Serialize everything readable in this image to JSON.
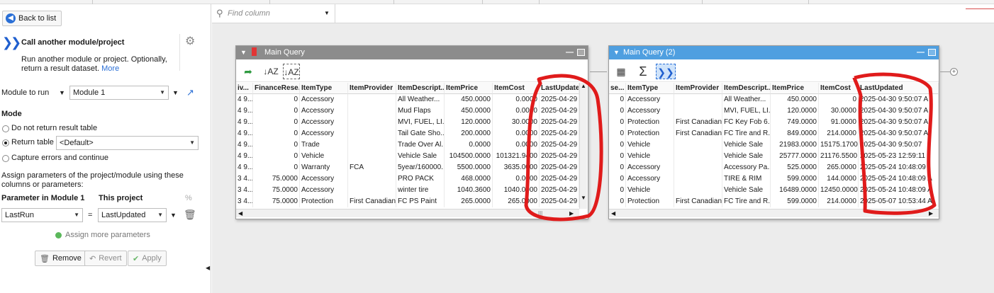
{
  "left": {
    "back_label": "Back to list",
    "header": {
      "title": "Call another module/project",
      "desc": "Run another module or project. Optionally, return a result dataset.",
      "more": "More"
    },
    "module_label": "Module to run",
    "module_value": "Module 1",
    "mode_title": "Mode",
    "modes": [
      "Do not return result table",
      "Return table",
      "Capture errors and continue"
    ],
    "return_table_value": "<Default>",
    "assign_text": "Assign parameters of the project/module using these columns or parameters:",
    "param_header": "Parameter in Module 1",
    "project_header": "This project",
    "param_value": "LastRun",
    "equals": "=",
    "project_value": "LastUpdated",
    "assign_more": "Assign more parameters",
    "buttons": {
      "remove": "Remove",
      "revert": "Revert",
      "apply": "Apply"
    }
  },
  "search": {
    "placeholder": "Find column"
  },
  "query1": {
    "title": "Main Query",
    "columns": [
      "iv...",
      "FinanceRese...",
      "ItemType",
      "ItemProvider",
      "ItemDescript...",
      "ItemPrice",
      "ItemCost",
      "LastUpdated"
    ],
    "rows": [
      [
        "4 9...",
        "0",
        "Accessory",
        "",
        "All Weather...",
        "450.0000",
        "0.0000",
        "2025-04-29"
      ],
      [
        "4 9...",
        "0",
        "Accessory",
        "",
        "Mud Flaps",
        "450.0000",
        "0.0000",
        "2025-04-29"
      ],
      [
        "4 9...",
        "0",
        "Accessory",
        "",
        "MVI, FUEL, LI...",
        "120.0000",
        "30.0000",
        "2025-04-29"
      ],
      [
        "4 9...",
        "0",
        "Accessory",
        "",
        "Tail Gate Sho...",
        "200.0000",
        "0.0000",
        "2025-04-29"
      ],
      [
        "4 9...",
        "0",
        "Trade",
        "",
        "Trade Over Al...",
        "0.0000",
        "0.0000",
        "2025-04-29"
      ],
      [
        "4 9...",
        "0",
        "Vehicle",
        "",
        "Vehicle Sale",
        "104500.0000",
        "101321.9400",
        "2025-04-29"
      ],
      [
        "4 9...",
        "0",
        "Warranty",
        "FCA",
        "5year/160000...",
        "5500.0000",
        "3635.0000",
        "2025-04-29"
      ],
      [
        "3 4...",
        "75.0000",
        "Accessory",
        "",
        "PRO PACK",
        "468.0000",
        "0.0000",
        "2025-04-29"
      ],
      [
        "3 4...",
        "75.0000",
        "Accessory",
        "",
        "winter tire",
        "1040.3600",
        "1040.0000",
        "2025-04-29"
      ],
      [
        "3 4...",
        "75.0000",
        "Protection",
        "First Canadian",
        "FC PS Paint",
        "265.0000",
        "265.0000",
        "2025-04-29"
      ]
    ]
  },
  "query2": {
    "title": "Main Query (2)",
    "columns": [
      "se...",
      "ItemType",
      "ItemProvider",
      "ItemDescript...",
      "ItemPrice",
      "ItemCost",
      "LastUpdated"
    ],
    "rows": [
      [
        "0",
        "Accessory",
        "",
        "All Weather...",
        "450.0000",
        "0",
        "2025-04-30 9:50:07 A"
      ],
      [
        "0",
        "Accessory",
        "",
        "MVI, FUEL, LI...",
        "120.0000",
        "30.0000",
        "2025-04-30 9:50:07 A"
      ],
      [
        "0",
        "Protection",
        "First Canadian",
        "FC Key Fob 6...",
        "749.0000",
        "91.0000",
        "2025-04-30 9:50:07 A"
      ],
      [
        "0",
        "Protection",
        "First Canadian",
        "FC Tire and R...",
        "849.0000",
        "214.0000",
        "2025-04-30 9:50:07 A"
      ],
      [
        "0",
        "Vehicle",
        "",
        "Vehicle Sale",
        "21983.0000",
        "15175.1700",
        "2025-04-30 9:50:07"
      ],
      [
        "0",
        "Vehicle",
        "",
        "Vehicle Sale",
        "25777.0000",
        "21176.5500",
        "2025-05-23 12:59:11"
      ],
      [
        "0",
        "Accessory",
        "",
        "Accessory Pa...",
        "525.0000",
        "265.0000",
        "2025-05-24 10:48:09"
      ],
      [
        "0",
        "Accessory",
        "",
        "TIRE & RIM",
        "599.0000",
        "144.0000",
        "2025-05-24 10:48:09 A"
      ],
      [
        "0",
        "Vehicle",
        "",
        "Vehicle Sale",
        "16489.0000",
        "12450.0000",
        "2025-05-24 10:48:09 A"
      ],
      [
        "0",
        "Protection",
        "First Canadian",
        "FC Tire and R...",
        "599.0000",
        "214.0000",
        "2025-05-07 10:53:44 A"
      ]
    ]
  },
  "colors": {
    "accent": "#2a6fd6",
    "panel1_title": "#8c8c8c",
    "panel2_title": "#4f9fe0",
    "annotation": "#e01b1b"
  }
}
